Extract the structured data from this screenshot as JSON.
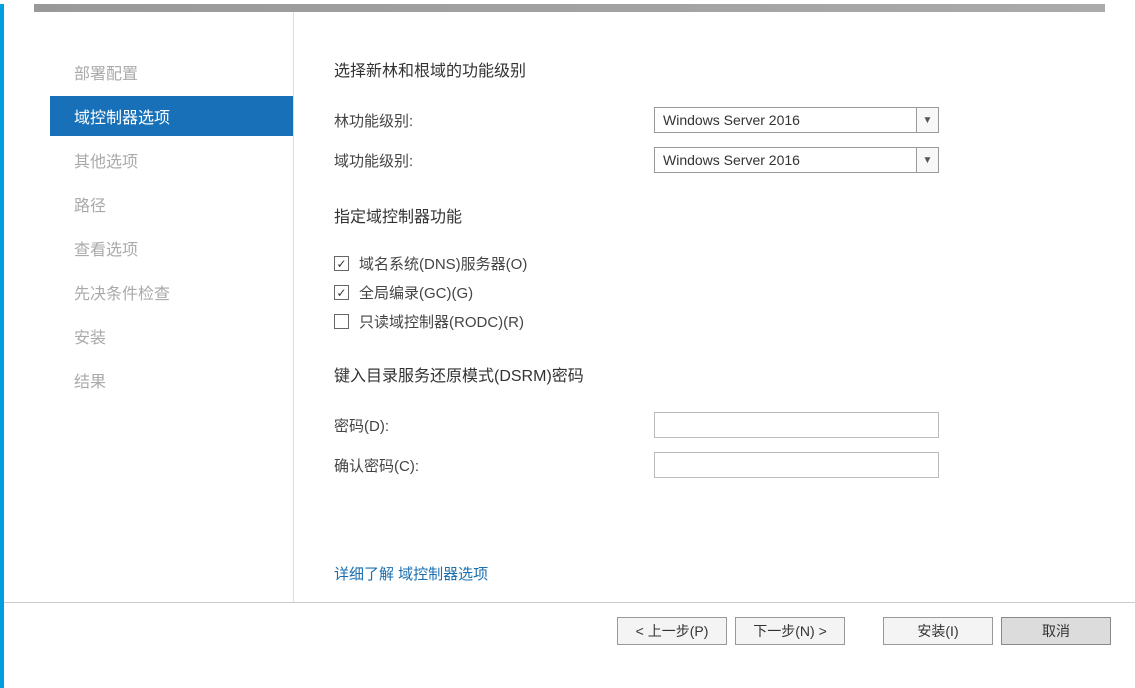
{
  "sidebar": {
    "items": [
      {
        "label": "部署配置"
      },
      {
        "label": "域控制器选项"
      },
      {
        "label": "其他选项"
      },
      {
        "label": "路径"
      },
      {
        "label": "查看选项"
      },
      {
        "label": "先决条件检查"
      },
      {
        "label": "安装"
      },
      {
        "label": "结果"
      }
    ]
  },
  "content": {
    "section1_title": "选择新林和根域的功能级别",
    "forest_level_label": "林功能级别:",
    "forest_level_value": "Windows Server 2016",
    "domain_level_label": "域功能级别:",
    "domain_level_value": "Windows Server 2016",
    "section2_title": "指定域控制器功能",
    "dns_label": "域名系统(DNS)服务器(O)",
    "gc_label": "全局编录(GC)(G)",
    "rodc_label": "只读域控制器(RODC)(R)",
    "section3_title": "键入目录服务还原模式(DSRM)密码",
    "password_label": "密码(D):",
    "confirm_password_label": "确认密码(C):",
    "more_link": "详细了解 域控制器选项"
  },
  "footer": {
    "prev": "< 上一步(P)",
    "next": "下一步(N) >",
    "install": "安装(I)",
    "cancel": "取消"
  }
}
